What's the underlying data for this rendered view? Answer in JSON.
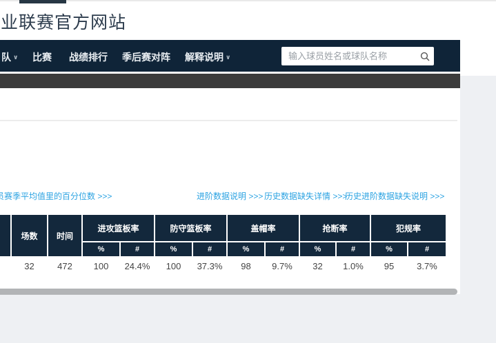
{
  "page": {
    "title": "业联赛官方网站"
  },
  "nav": {
    "items": [
      {
        "label": "队",
        "has_dropdown": true
      },
      {
        "label": "比赛",
        "has_dropdown": false
      },
      {
        "label": "战绩排行",
        "has_dropdown": false
      },
      {
        "label": "季后赛对阵",
        "has_dropdown": false
      },
      {
        "label": "解释说明",
        "has_dropdown": true
      }
    ],
    "search": {
      "placeholder": "输入球员姓名或球队名称",
      "value": ""
    }
  },
  "icons": {
    "chevron_down": "∨"
  },
  "links": {
    "left": "员赛季平均值里的百分位数 >>>",
    "right": [
      "进阶数据说明 >>>",
      "历史数据缺失详情 >>>",
      "历史进阶数据缺失说明 >>>"
    ]
  },
  "table": {
    "columns": {
      "games": "场数",
      "time": "时间",
      "groups": [
        {
          "label": "进攻篮板率"
        },
        {
          "label": "防守篮板率"
        },
        {
          "label": "盖帽率"
        },
        {
          "label": "抢断率"
        },
        {
          "label": "犯规率"
        }
      ],
      "sub_pct": "%",
      "sub_num": "#"
    },
    "row": {
      "games": "32",
      "time": "472",
      "stats": [
        {
          "pct": "100",
          "pct_color": "orange",
          "num": "24.4%"
        },
        {
          "pct": "100",
          "pct_color": "orange",
          "num": "37.3%"
        },
        {
          "pct": "98",
          "pct_color": "orange",
          "num": "9.7%"
        },
        {
          "pct": "32",
          "pct_color": "blue",
          "num": "1.0%"
        },
        {
          "pct": "95",
          "pct_color": "orange",
          "num": "3.7%"
        }
      ]
    }
  },
  "colors": {
    "navy_header": "#13283c",
    "navbar": "#0f2438",
    "orange_cell": "#f7941e",
    "blue_cell": "#a9cdef",
    "link_blue": "#2ca3e2",
    "page_gray": "#eef0f3"
  }
}
